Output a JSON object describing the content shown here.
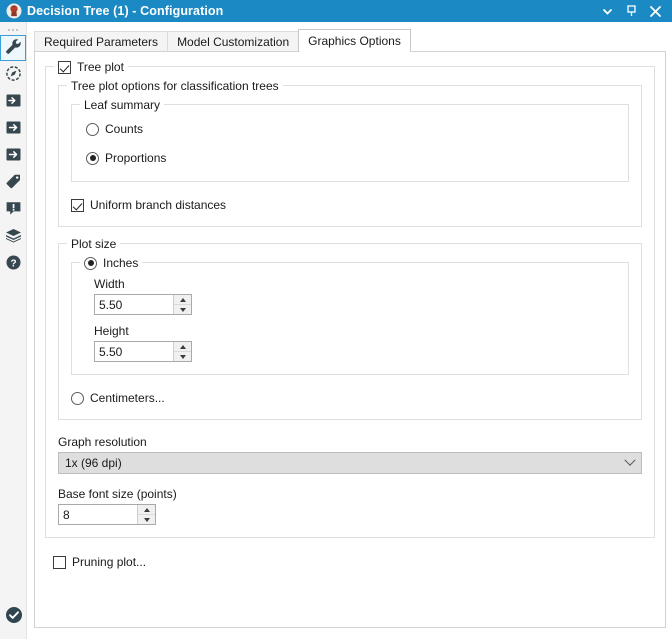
{
  "window": {
    "title": "Decision Tree (1) - Configuration",
    "icon": "decision-tree-icon",
    "accent_color": "#1b8ac4",
    "controls": {
      "minimize_label": "▼",
      "pin_label": "⚲",
      "close_label": "✕"
    }
  },
  "sidebar": {
    "items": [
      {
        "name": "wrench-icon",
        "selected": true
      },
      {
        "name": "compass-icon",
        "selected": false
      },
      {
        "name": "input-arrow-icon",
        "selected": false
      },
      {
        "name": "output-arrow-icon",
        "selected": false
      },
      {
        "name": "output-arrow-2-icon",
        "selected": false
      },
      {
        "name": "tag-icon",
        "selected": false
      },
      {
        "name": "warning-callout-icon",
        "selected": false
      },
      {
        "name": "package-icon",
        "selected": false
      },
      {
        "name": "help-icon",
        "selected": false
      }
    ],
    "status_icon": "check-circle-icon"
  },
  "tabs": [
    {
      "label": "Required Parameters",
      "active": false
    },
    {
      "label": "Model Customization",
      "active": false
    },
    {
      "label": "Graphics Options",
      "active": true
    }
  ],
  "form": {
    "tree_plot": {
      "label": "Tree plot",
      "checked": true
    },
    "classification_group": {
      "label": "Tree plot options for classification trees"
    },
    "leaf_summary": {
      "label": "Leaf summary",
      "options": [
        {
          "label": "Counts",
          "selected": false
        },
        {
          "label": "Proportions",
          "selected": true
        }
      ]
    },
    "uniform_branch": {
      "label": "Uniform branch distances",
      "checked": true
    },
    "plot_size": {
      "label": "Plot size",
      "inches": {
        "label": "Inches",
        "selected": true,
        "width": {
          "label": "Width",
          "value": "5.50"
        },
        "height": {
          "label": "Height",
          "value": "5.50"
        }
      },
      "centimeters": {
        "label": "Centimeters...",
        "selected": false
      }
    },
    "graph_resolution": {
      "label": "Graph resolution",
      "value": "1x (96 dpi)"
    },
    "base_font_size": {
      "label": "Base font size (points)",
      "value": "8"
    },
    "pruning_plot": {
      "label": "Pruning plot...",
      "checked": false
    }
  }
}
